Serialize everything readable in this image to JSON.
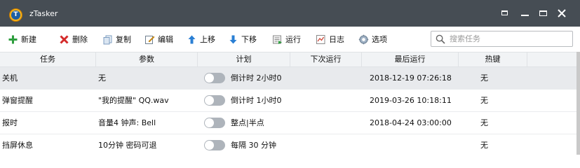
{
  "window": {
    "title": "zTasker",
    "app_icon_letter": "T"
  },
  "toolbar": {
    "new_label": "新建",
    "delete_label": "删除",
    "copy_label": "复制",
    "edit_label": "编辑",
    "move_up_label": "上移",
    "move_down_label": "下移",
    "run_label": "运行",
    "log_label": "日志",
    "options_label": "选项",
    "search_placeholder": "搜索任务",
    "search_value": ""
  },
  "table": {
    "headers": [
      "任务",
      "参数",
      "计划",
      "下次运行",
      "最后运行",
      "热键"
    ],
    "rows": [
      {
        "task": "关机",
        "params": "无",
        "enabled": false,
        "plan": "倒计时 2小时0",
        "next_run": "",
        "last_run": "2018-12-19 07:26:18",
        "hotkey": "无",
        "selected": true
      },
      {
        "task": "弹窗提醒",
        "params": "\"我的提醒\" QQ.wav",
        "enabled": false,
        "plan": "倒计时 1小时0",
        "next_run": "",
        "last_run": "2019-03-26 10:18:11",
        "hotkey": "无",
        "selected": false
      },
      {
        "task": "报时",
        "params": "音量4 钟声: Bell",
        "enabled": false,
        "plan": "整点|半点",
        "next_run": "",
        "last_run": "2018-04-24 03:00:00",
        "hotkey": "无",
        "selected": false
      },
      {
        "task": "挡屏休息",
        "params": "10分钟 密码可退",
        "enabled": false,
        "plan": "每隔 30 分钟",
        "next_run": "",
        "last_run": "",
        "hotkey": "无",
        "selected": false
      }
    ]
  },
  "colors": {
    "titlebar": "#464d54",
    "new_icon": "#2e9e3e",
    "delete_icon": "#d42a2a",
    "move_icon": "#2a7fd4",
    "toggle_off": "#aeb4bb",
    "selected_row": "#e8eaed"
  }
}
